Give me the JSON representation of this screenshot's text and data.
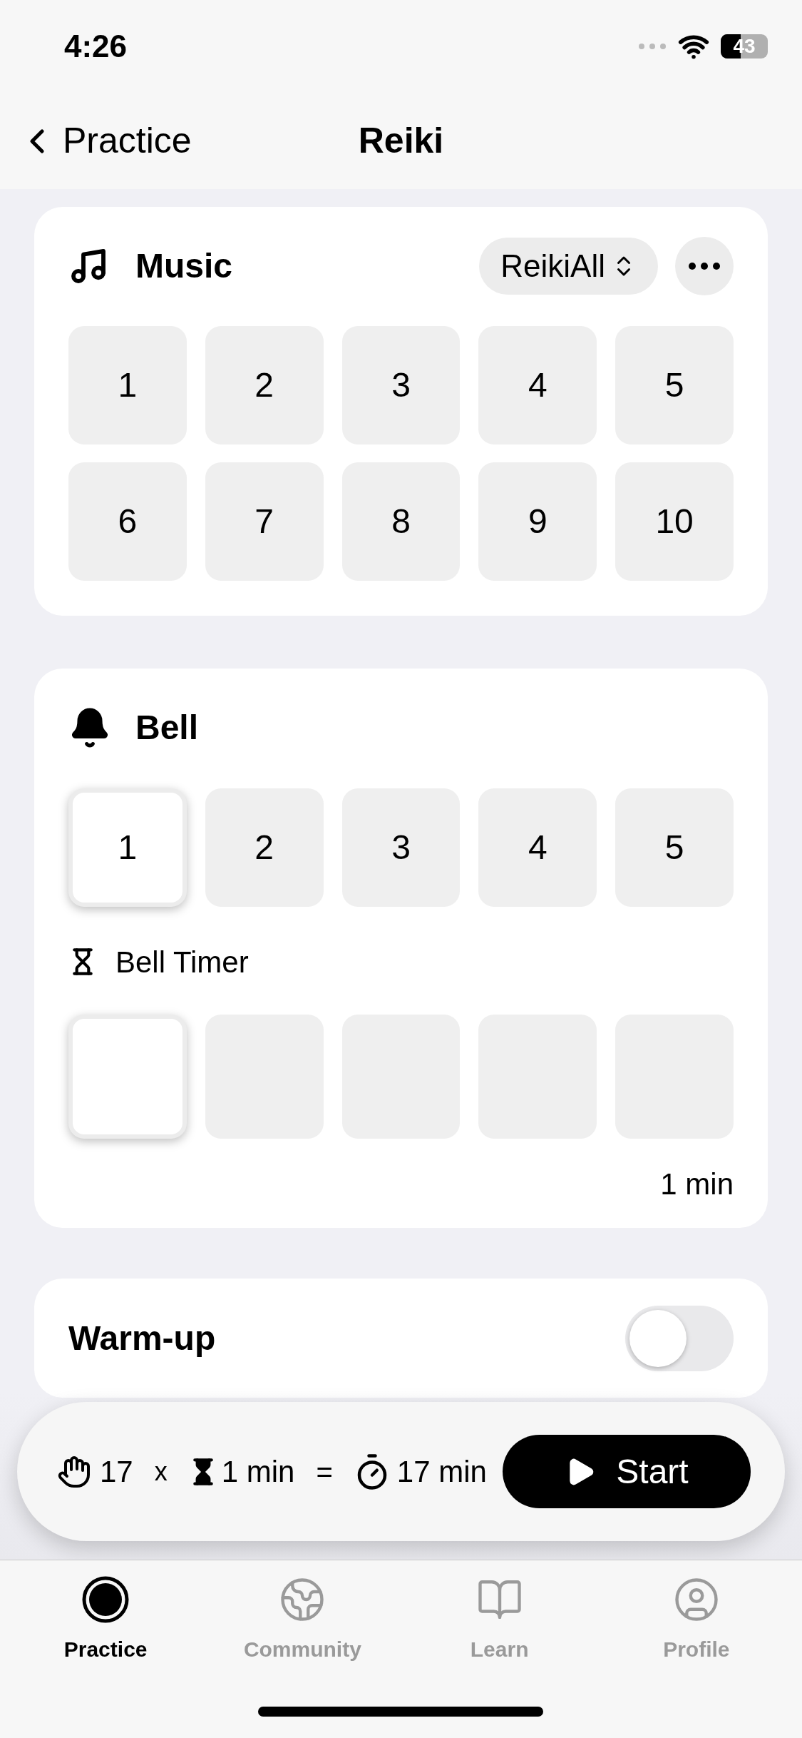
{
  "status_bar": {
    "time": "4:26",
    "battery": "43"
  },
  "nav": {
    "back": "Practice",
    "title": "Reiki"
  },
  "music": {
    "title": "Music",
    "playlist": "ReikiAll",
    "tracks": [
      {
        "label": "1",
        "selected": false
      },
      {
        "label": "2",
        "selected": false
      },
      {
        "label": "3",
        "selected": false
      },
      {
        "label": "4",
        "selected": false
      },
      {
        "label": "5",
        "selected": false
      },
      {
        "label": "6",
        "selected": false
      },
      {
        "label": "7",
        "selected": false
      },
      {
        "label": "8",
        "selected": false
      },
      {
        "label": "9",
        "selected": false
      },
      {
        "label": "10",
        "selected": false
      }
    ]
  },
  "bell": {
    "title": "Bell",
    "options": [
      {
        "label": "1",
        "selected": true
      },
      {
        "label": "2",
        "selected": false
      },
      {
        "label": "3",
        "selected": false
      },
      {
        "label": "4",
        "selected": false
      },
      {
        "label": "5",
        "selected": false
      }
    ],
    "timer_label": "Bell Timer",
    "timer_slots": [
      {
        "selected": true
      },
      {
        "selected": false
      },
      {
        "selected": false
      },
      {
        "selected": false
      },
      {
        "selected": false
      }
    ],
    "timer_reading": "1 min"
  },
  "warmup": {
    "label": "Warm-up",
    "on": false
  },
  "summary": {
    "count": "17",
    "times": "x",
    "duration": "1 min",
    "equals": "=",
    "total": "17 min",
    "start": "Start"
  },
  "tabs": [
    {
      "label": "Practice",
      "selected": true
    },
    {
      "label": "Community",
      "selected": false
    },
    {
      "label": "Learn",
      "selected": false
    },
    {
      "label": "Profile",
      "selected": false
    }
  ]
}
